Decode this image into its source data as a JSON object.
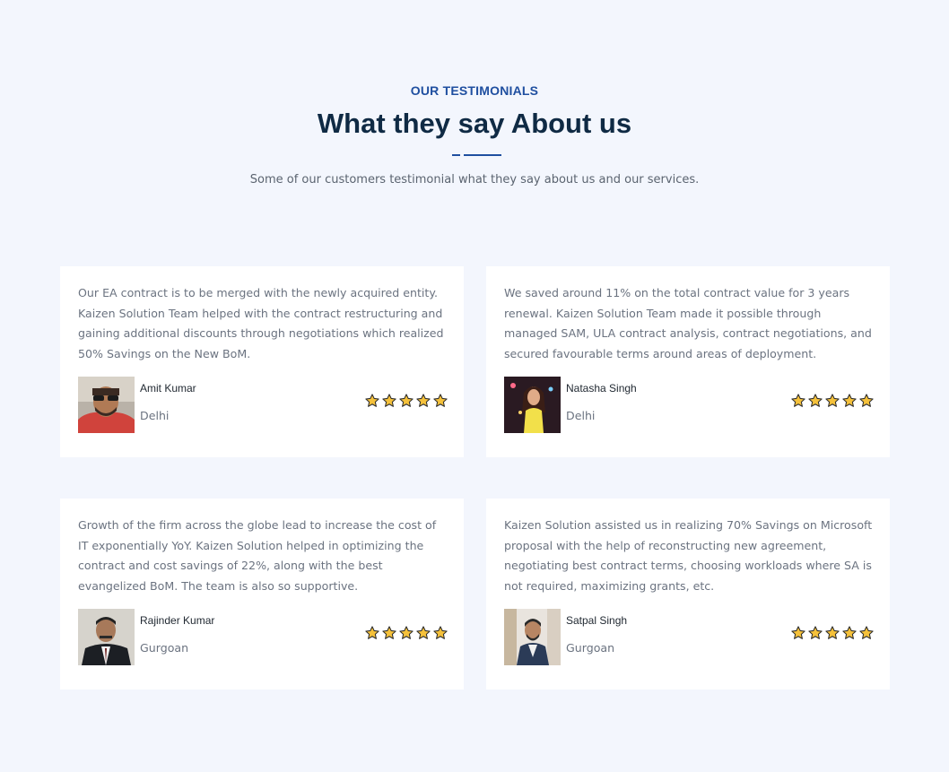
{
  "header": {
    "eyebrow": "OUR TESTIMONIALS",
    "title": "What they say About us",
    "subtitle": "Some of our customers testimonial what they say about us and our services."
  },
  "colors": {
    "accent": "#1f4fa0",
    "heading": "#0f2a44",
    "star_fill": "#f5c13b",
    "star_stroke": "#2b2b2b",
    "background": "#f3f6fd"
  },
  "testimonials": [
    {
      "quote": "Our EA contract is to be merged with the newly acquired entity. Kaizen Solution Team helped with the contract restructuring and gaining additional discounts through negotiations which realized 50% Savings on the New BoM.",
      "name": "Amit Kumar",
      "city": "Delhi",
      "rating": 5,
      "avatar_icon": "person-photo-icon"
    },
    {
      "quote": "We saved around 11% on the total contract value for 3 years renewal. Kaizen Solution Team made it possible through managed SAM, ULA contract analysis, contract negotiations, and secured favourable terms around areas of deployment.",
      "name": "Natasha Singh",
      "city": "Delhi",
      "rating": 5,
      "avatar_icon": "person-photo-icon"
    },
    {
      "quote": "Growth of the firm across the globe lead to increase the cost of IT exponentially YoY. Kaizen Solution helped in optimizing the contract and cost savings of 22%, along with the best evangelized BoM. The team is also so supportive.",
      "name": "Rajinder Kumar",
      "city": "Gurgoan",
      "rating": 5,
      "avatar_icon": "person-photo-icon"
    },
    {
      "quote": "Kaizen Solution assisted us in realizing 70% Savings on Microsoft proposal with the help of reconstructing new agreement, negotiating best contract terms, choosing workloads where SA is not required, maximizing grants, etc.",
      "name": "Satpal Singh",
      "city": "Gurgoan",
      "rating": 5,
      "avatar_icon": "person-photo-icon"
    }
  ]
}
